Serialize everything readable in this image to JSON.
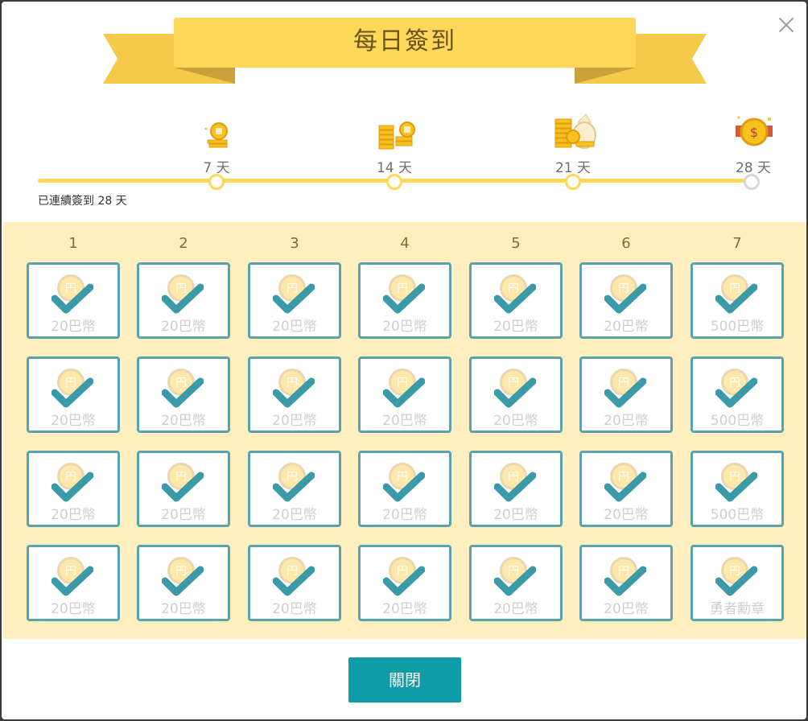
{
  "title": "每日簽到",
  "streak_text": "已連續簽到 28 天",
  "milestones": [
    {
      "label": "7 天",
      "icon": "coin-stack-small-icon"
    },
    {
      "label": "14 天",
      "icon": "coin-stacks-icon"
    },
    {
      "label": "21 天",
      "icon": "money-bag-icon"
    },
    {
      "label": "28 天",
      "icon": "medal-icon"
    }
  ],
  "columns": [
    "1",
    "2",
    "3",
    "4",
    "5",
    "6",
    "7"
  ],
  "rows": [
    [
      "20巴幣",
      "20巴幣",
      "20巴幣",
      "20巴幣",
      "20巴幣",
      "20巴幣",
      "500巴幣"
    ],
    [
      "20巴幣",
      "20巴幣",
      "20巴幣",
      "20巴幣",
      "20巴幣",
      "20巴幣",
      "500巴幣"
    ],
    [
      "20巴幣",
      "20巴幣",
      "20巴幣",
      "20巴幣",
      "20巴幣",
      "20巴幣",
      "500巴幣"
    ],
    [
      "20巴幣",
      "20巴幣",
      "20巴幣",
      "20巴幣",
      "20巴幣",
      "20巴幣",
      "勇者勳章"
    ]
  ],
  "close_button": "關閉",
  "colors": {
    "ribbon": "#ffd85a",
    "track": "#ffd85a",
    "grid_bg": "#ffefbe",
    "cell_border": "#5aa2ad",
    "check": "#3a9aa7",
    "button": "#0f9ba8"
  }
}
